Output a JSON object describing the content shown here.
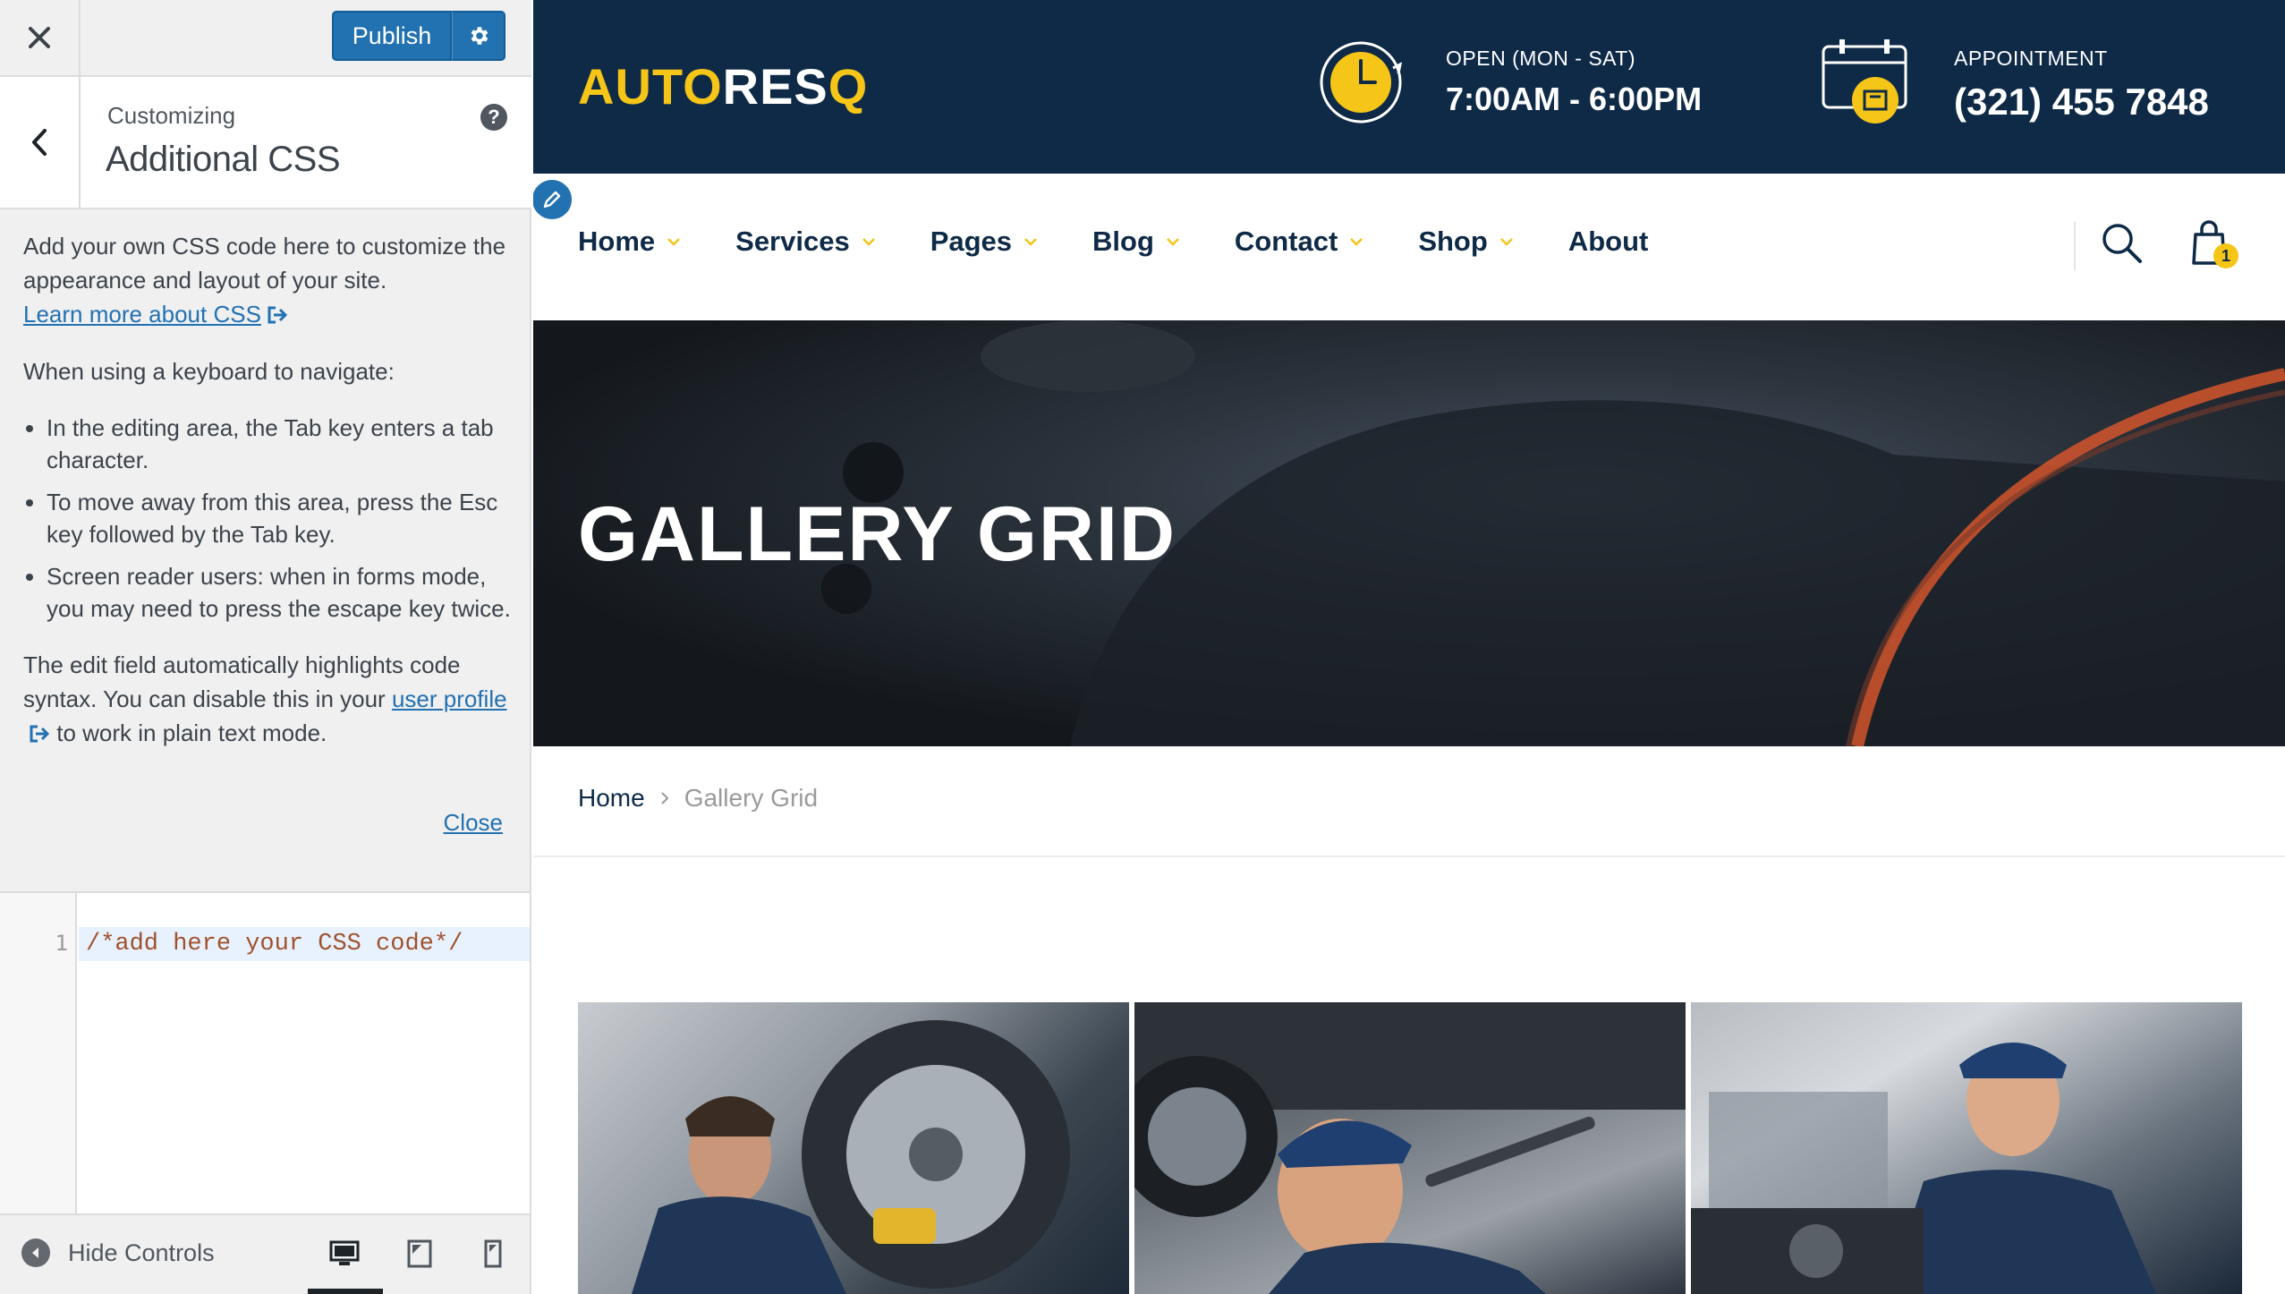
{
  "customizer": {
    "close_label": "Close customizer",
    "publish_label": "Publish",
    "customizing_label": "Customizing",
    "section_title": "Additional CSS",
    "help_label": "?",
    "description": {
      "intro": "Add your own CSS code here to customize the appearance and layout of your site.",
      "learn_more_link": "Learn more about CSS",
      "keyboard_heading": "When using a keyboard to navigate:",
      "bullets": [
        "In the editing area, the Tab key enters a tab character.",
        "To move away from this area, press the Esc key followed by the Tab key.",
        "Screen reader users: when in forms mode, you may need to press the escape key twice."
      ],
      "syntax_before": "The edit field automatically highlights code syntax. You can disable this in your ",
      "user_profile_link": "user profile",
      "syntax_after": " to work in plain text mode.",
      "close_link": "Close"
    },
    "editor": {
      "line_number": "1",
      "code": "/*add here your CSS code*/"
    },
    "footer": {
      "hide_controls": "Hide Controls"
    }
  },
  "site": {
    "logo_part1": "AUTO",
    "logo_part2": "RES",
    "logo_part3": "Q",
    "hours_label": "OPEN (MON - SAT)",
    "hours_value": "7:00AM - 6:00PM",
    "appointment_label": "APPOINTMENT",
    "appointment_phone": "(321) 455 7848",
    "nav": [
      {
        "label": "Home",
        "dropdown": true
      },
      {
        "label": "Services",
        "dropdown": true
      },
      {
        "label": "Pages",
        "dropdown": true
      },
      {
        "label": "Blog",
        "dropdown": true
      },
      {
        "label": "Contact",
        "dropdown": true
      },
      {
        "label": "Shop",
        "dropdown": true
      },
      {
        "label": "About",
        "dropdown": false
      }
    ],
    "cart_count": "1",
    "hero_title": "GALLERY GRID",
    "breadcrumb": {
      "home": "Home",
      "current": "Gallery Grid"
    },
    "colors": {
      "navy": "#0e2a47",
      "accent": "#f5c518",
      "wp_blue": "#2271b1"
    }
  }
}
